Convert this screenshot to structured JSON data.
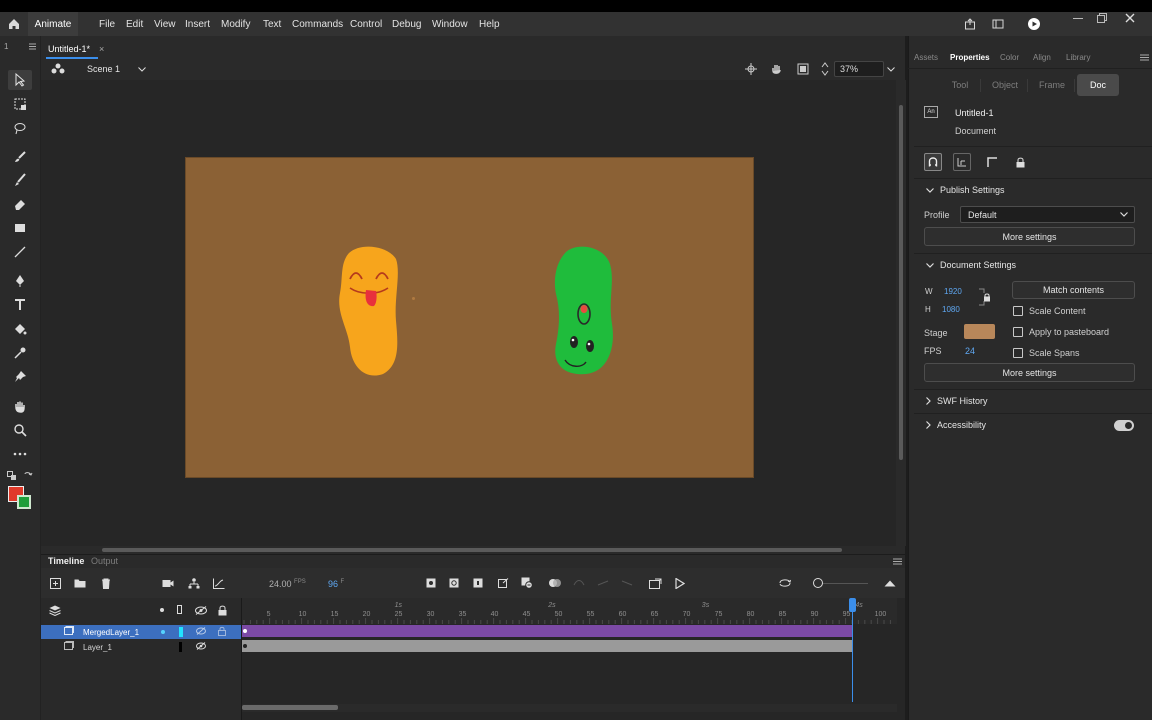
{
  "app": {
    "name": "Animate"
  },
  "menu": [
    "File",
    "Edit",
    "View",
    "Insert",
    "Modify",
    "Text",
    "Commands",
    "Control",
    "Debug",
    "Window",
    "Help"
  ],
  "document": {
    "tab_title": "Untitled-1*",
    "scene": "Scene 1",
    "zoom": "37%"
  },
  "timeline": {
    "tabs": [
      "Timeline",
      "Output"
    ],
    "fps": "24.00",
    "fps_unit": "FPS",
    "frame": "96",
    "frame_unit": "F",
    "time_markers": [
      "1s",
      "2s",
      "3s",
      "4s"
    ],
    "frame_ticks": [
      "5",
      "10",
      "15",
      "20",
      "25",
      "30",
      "35",
      "40",
      "45",
      "50",
      "55",
      "60",
      "65",
      "70",
      "75",
      "80",
      "85",
      "90",
      "95",
      "100"
    ],
    "layers": [
      {
        "name": "MergedLayer_1",
        "selected": true
      },
      {
        "name": "Layer_1",
        "selected": false
      }
    ]
  },
  "right_panel": {
    "tabs": [
      "Assets",
      "Properties",
      "Color",
      "Align",
      "Library"
    ],
    "active_tab": "Properties",
    "subtabs": [
      "Tool",
      "Object",
      "Frame",
      "Doc"
    ],
    "active_subtab": "Doc",
    "doc_name": "Untitled-1",
    "doc_type": "Document",
    "doc_badge": "An",
    "publish": {
      "title": "Publish Settings",
      "profile_label": "Profile",
      "profile_value": "Default",
      "more": "More settings"
    },
    "docsettings": {
      "title": "Document Settings",
      "w_label": "W",
      "w_value": "1920",
      "h_label": "H",
      "h_value": "1080",
      "match": "Match contents",
      "scale_content": "Scale Content",
      "stage_label": "Stage",
      "stage_color": "#b8875a",
      "apply_pasteboard": "Apply to pasteboard",
      "fps_label": "FPS",
      "fps_value": "24",
      "scale_spans": "Scale Spans",
      "more": "More settings"
    },
    "swf_history": "SWF History",
    "accessibility": "Accessibility"
  },
  "colors": {
    "stage": "#8b6135",
    "accent": "#3b8eea",
    "layer_span": "#7c4aa6"
  }
}
